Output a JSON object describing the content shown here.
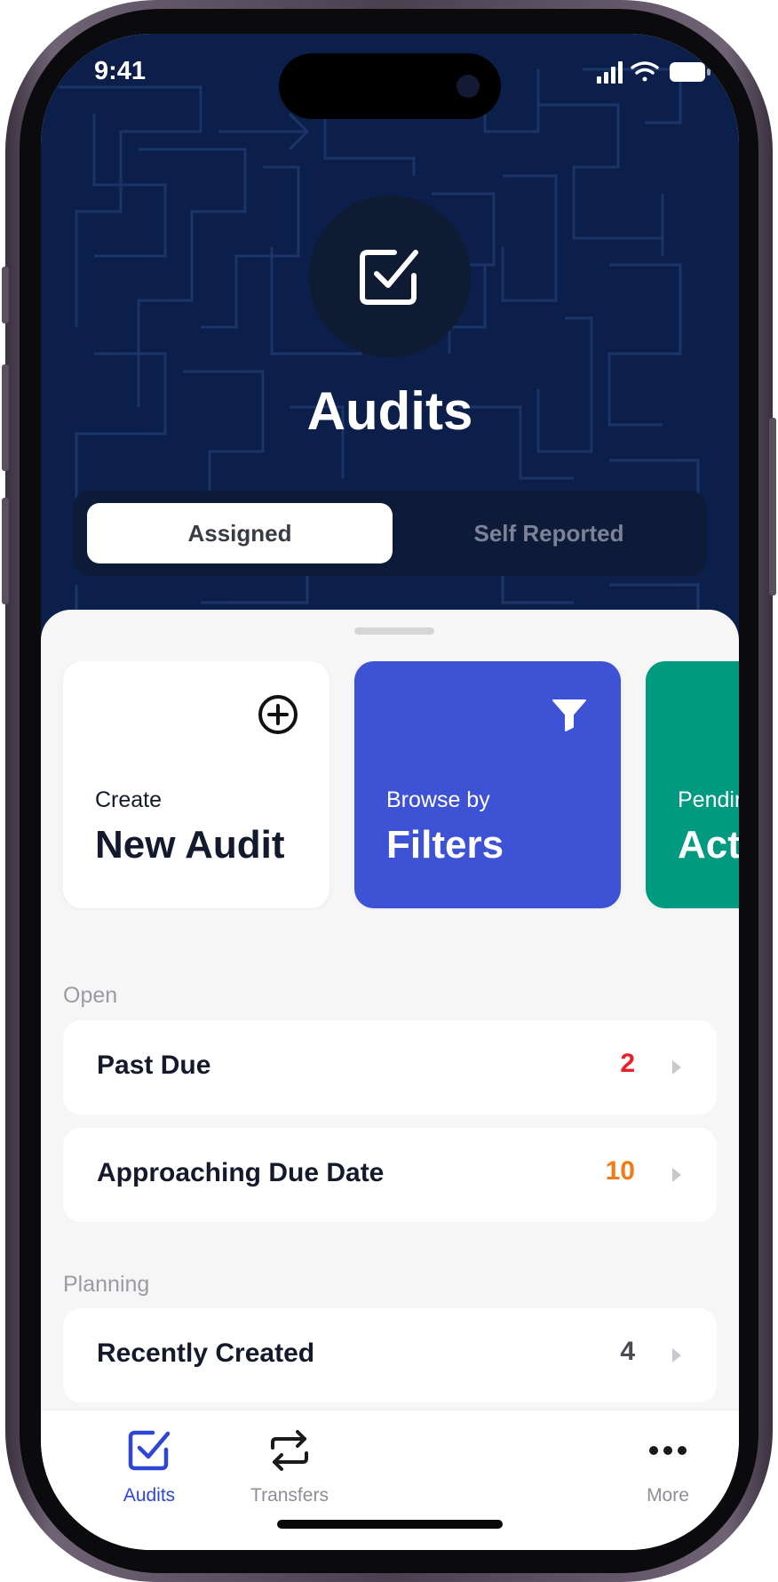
{
  "status_bar": {
    "time": "9:41"
  },
  "header": {
    "title": "Audits",
    "icon": "checkbox-icon",
    "segments": [
      {
        "label": "Assigned",
        "selected": true
      },
      {
        "label": "Self Reported",
        "selected": false
      }
    ]
  },
  "cards": [
    {
      "subtitle": "Create",
      "title": "New Audit",
      "icon": "add-circle-icon"
    },
    {
      "subtitle": "Browse by",
      "title": "Filters",
      "icon": "filter-icon"
    },
    {
      "subtitle": "Pending",
      "title": "Actions"
    }
  ],
  "sections": [
    {
      "label": "Open",
      "items": [
        {
          "label": "Past Due",
          "count": "2"
        },
        {
          "label": "Approaching Due Date",
          "count": "10"
        }
      ]
    },
    {
      "label": "Planning",
      "items": [
        {
          "label": "Recently Created",
          "count": "4"
        }
      ]
    }
  ],
  "tab_bar": {
    "tabs": [
      {
        "label": "Audits",
        "icon": "audits-check-icon",
        "active": true
      },
      {
        "label": "Transfers",
        "icon": "transfer-arrows-icon",
        "active": false
      },
      {
        "label": "More",
        "icon": "more-dots-icon",
        "active": false
      }
    ]
  },
  "colors": {
    "header_bg": "#0b1f4a",
    "accent_blue": "#3d52d5",
    "accent_green": "#009a80",
    "past_due": "#e8202a",
    "approaching": "#f07c16",
    "neutral_count": "#4a4c55",
    "tab_active": "#2e46d8"
  }
}
